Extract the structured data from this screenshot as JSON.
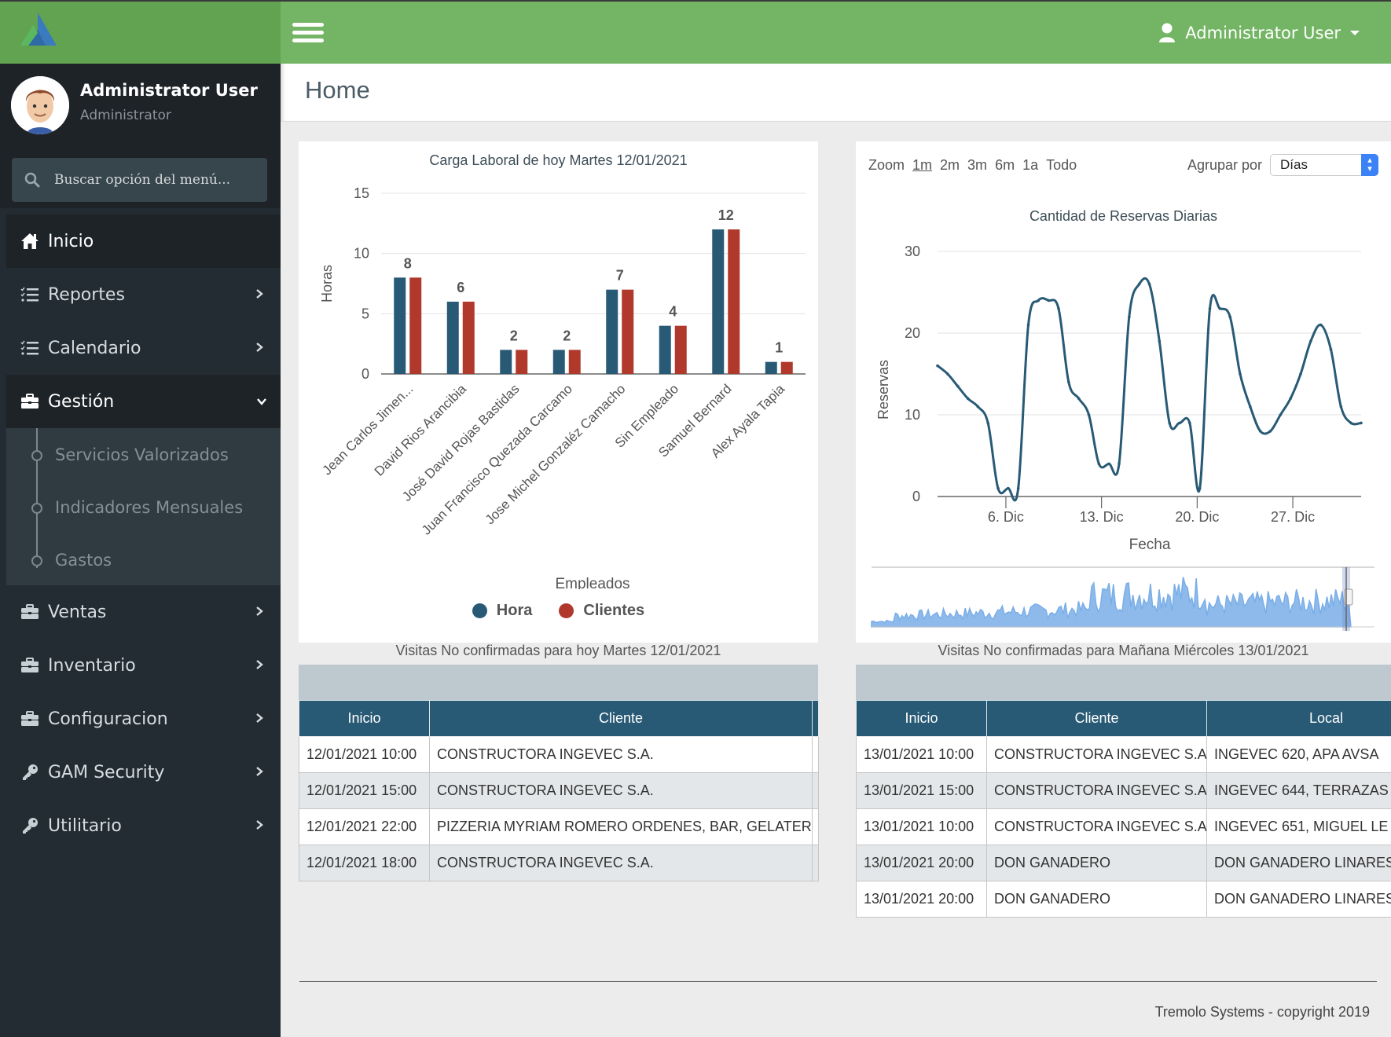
{
  "app": {
    "user_menu_label": "Administrator User",
    "page_title": "Home",
    "footer": "Tremolo Systems - copyright 2019"
  },
  "profile": {
    "name": "Administrator User",
    "role": "Administrator"
  },
  "search": {
    "placeholder": "Buscar opción del menú..."
  },
  "sidebar": {
    "items": [
      {
        "label": "Inicio",
        "icon": "home-icon"
      },
      {
        "label": "Reportes",
        "icon": "tasks-icon"
      },
      {
        "label": "Calendario",
        "icon": "tasks-icon"
      },
      {
        "label": "Gestión",
        "icon": "briefcase-icon"
      },
      {
        "label": "Ventas",
        "icon": "briefcase-icon"
      },
      {
        "label": "Inventario",
        "icon": "briefcase-icon"
      },
      {
        "label": "Configuracion",
        "icon": "briefcase-icon"
      },
      {
        "label": "GAM Security",
        "icon": "key-icon"
      },
      {
        "label": "Utilitario",
        "icon": "key-icon"
      }
    ],
    "gestion_sub": [
      {
        "label": "Servicios Valorizados"
      },
      {
        "label": "Indicadores Mensuales"
      },
      {
        "label": "Gastos"
      }
    ]
  },
  "colors": {
    "brand_green": "#73b564",
    "series_hora": "#295a75",
    "series_clientes": "#b0392b",
    "navigator": "#7aaee8"
  },
  "range_selector": {
    "zoom_label": "Zoom",
    "buttons": [
      "1m",
      "2m",
      "3m",
      "6m",
      "1a",
      "Todo"
    ],
    "selected": "1m",
    "group_by_label": "Agrupar por",
    "group_by_value": "Días"
  },
  "chart_data": [
    {
      "type": "bar",
      "title": "Carga Laboral de hoy Martes 12/01/2021",
      "xlabel": "Empleados",
      "ylabel": "Horas",
      "ylim": [
        0,
        15
      ],
      "yticks": [
        0,
        5,
        10,
        15
      ],
      "grid": true,
      "legend": "bottom-center",
      "categories": [
        "Jean Carlos Jimen...",
        "David Rios Arancibia",
        "José David Rojas Bastidas",
        "Juan Francisco Quezada Carcamo",
        "Jose Michel Gonzaléz Camacho",
        "Sin Empleado",
        "Samuel Bernard",
        "Alex Ayala Tapia"
      ],
      "series": [
        {
          "name": "Hora",
          "values": [
            8,
            6,
            2,
            2,
            7,
            4,
            12,
            1
          ]
        },
        {
          "name": "Clientes",
          "values": [
            8,
            6,
            2,
            2,
            7,
            4,
            12,
            1
          ]
        }
      ]
    },
    {
      "type": "line",
      "title": "Cantidad de Reservas Diarias",
      "xlabel": "Fecha",
      "ylabel": "Reservas",
      "ylim": [
        0,
        30
      ],
      "yticks": [
        0,
        10,
        20,
        30
      ],
      "xticks": [
        "6. Dic",
        "13. Dic",
        "20. Dic",
        "27. Dic"
      ],
      "grid": true,
      "x_start_day": 0,
      "x_tick_days": [
        5,
        12,
        19,
        26
      ],
      "x_range_days": [
        0,
        31
      ],
      "series": [
        {
          "name": "Reservas",
          "values": [
            16,
            15,
            13.5,
            12,
            11,
            9,
            1,
            1,
            1,
            21,
            24,
            24,
            23,
            14,
            12,
            10,
            4,
            4,
            4,
            22,
            26,
            26,
            19,
            9,
            9,
            9,
            1,
            23,
            23,
            22,
            15,
            11,
            8,
            8,
            10,
            12,
            15,
            19,
            21,
            18,
            11,
            9,
            9
          ]
        }
      ]
    }
  ],
  "table_today": {
    "caption": "Visitas No confirmadas para hoy Martes 12/01/2021",
    "columns": [
      "Inicio",
      "Cliente"
    ],
    "rows": [
      [
        "12/01/2021 10:00",
        "CONSTRUCTORA INGEVEC S.A."
      ],
      [
        "12/01/2021 15:00",
        "CONSTRUCTORA INGEVEC S.A."
      ],
      [
        "12/01/2021 22:00",
        "PIZZERIA MYRIAM ROMERO ORDENES, BAR, GELATERIA"
      ],
      [
        "12/01/2021 18:00",
        "CONSTRUCTORA INGEVEC S.A."
      ]
    ]
  },
  "table_tomorrow": {
    "caption": "Visitas No confirmadas para Mañana Miércoles 13/01/2021",
    "columns": [
      "Inicio",
      "Cliente",
      "Local"
    ],
    "rows": [
      [
        "13/01/2021 10:00",
        "CONSTRUCTORA INGEVEC S.A.",
        "INGEVEC 620, APA AVSA"
      ],
      [
        "13/01/2021 15:00",
        "CONSTRUCTORA INGEVEC S.A.",
        "INGEVEC 644, TERRAZAS"
      ],
      [
        "13/01/2021 10:00",
        "CONSTRUCTORA INGEVEC S.A.",
        "INGEVEC 651, MIGUEL LE"
      ],
      [
        "13/01/2021 20:00",
        "DON GANADERO",
        "DON GANADERO LINARES"
      ],
      [
        "13/01/2021 20:00",
        "DON GANADERO",
        "DON GANADERO LINARES"
      ]
    ]
  }
}
